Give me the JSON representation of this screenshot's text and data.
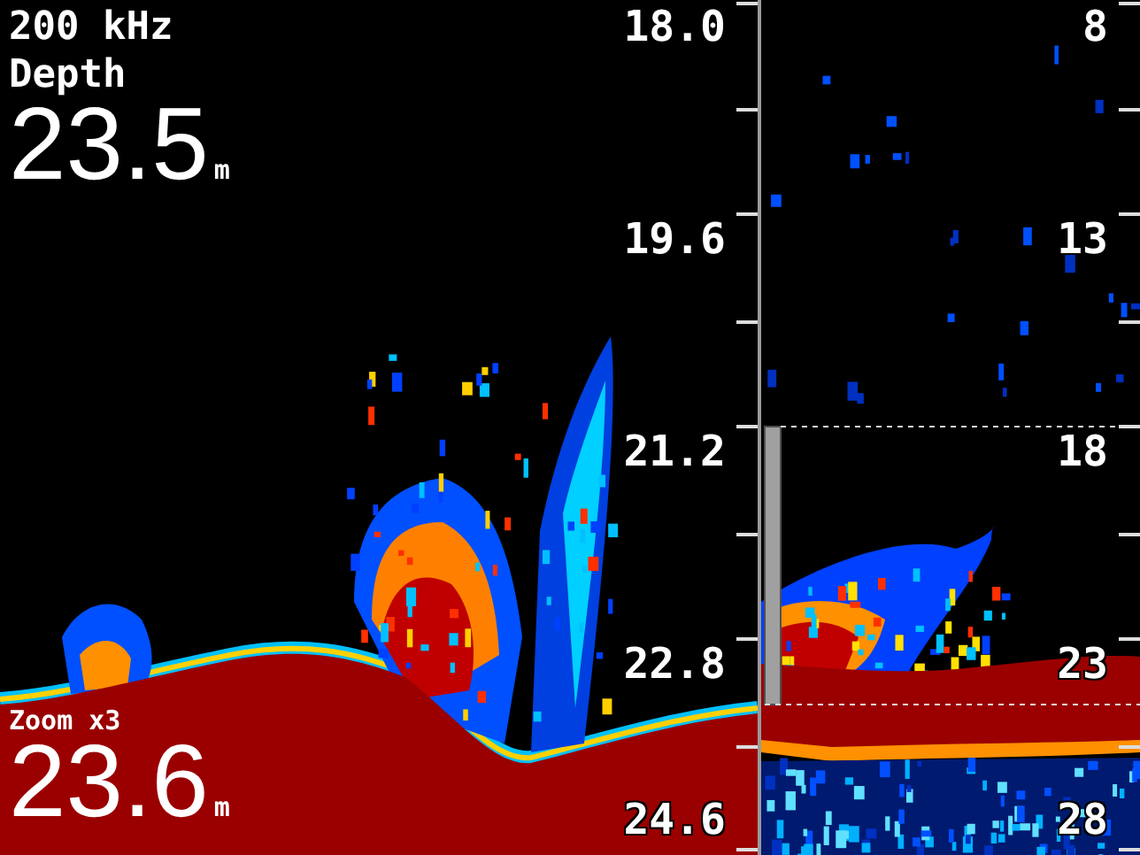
{
  "frequency": "200 kHz",
  "depth": {
    "label": "Depth",
    "value": "23.5",
    "unit": "m"
  },
  "zoom": {
    "label": "Zoom x3",
    "value": "23.6",
    "unit": "m"
  },
  "zoom_scale": [
    "18.0",
    "19.6",
    "21.2",
    "22.8",
    "24.6"
  ],
  "main_scale": [
    "8",
    "13",
    "18",
    "23",
    "28"
  ]
}
